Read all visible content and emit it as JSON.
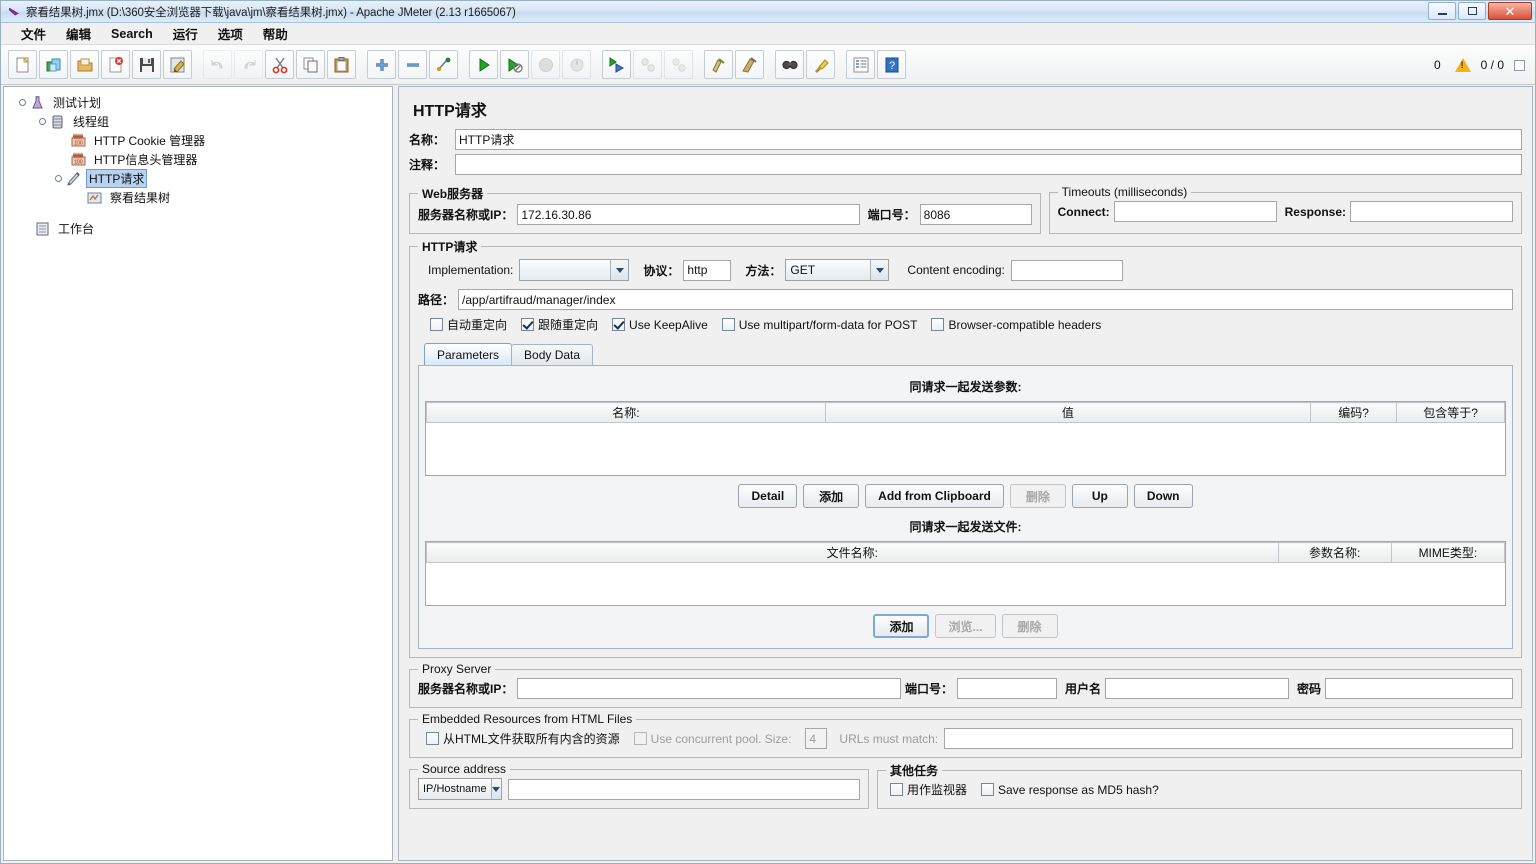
{
  "window": {
    "title": "察看结果树.jmx (D:\\360安全浏览器下载\\java\\jm\\察看结果树.jmx) - Apache JMeter (2.13 r1665067)",
    "minimize": "−",
    "maximize": "□",
    "close": "✕"
  },
  "menu": {
    "items": [
      "文件",
      "编辑",
      "Search",
      "运行",
      "选项",
      "帮助"
    ]
  },
  "toolbar": {
    "icons": [
      "new-icon",
      "templates-icon",
      "open-icon",
      "close-icon",
      "save-icon",
      "save-as-icon",
      "undo-icon",
      "redo-icon",
      "cut-icon",
      "copy-icon",
      "paste-icon",
      "expand-icon",
      "collapse-icon",
      "toggle-icon",
      "start-icon",
      "start-no-timers-icon",
      "stop-icon",
      "shutdown-icon",
      "remote-start-all-icon",
      "remote-stop-all-icon",
      "remote-shutdown-all-icon",
      "clear-icon",
      "clear-all-icon",
      "search-icon",
      "search-reset-icon",
      "function-helper-icon",
      "help-icon"
    ],
    "warning_count": "0",
    "thread_count": "0 / 0"
  },
  "tree": {
    "nodes": [
      {
        "label": "测试计划",
        "icon": "test-plan-icon",
        "depth": 0,
        "selected": false,
        "expander": true
      },
      {
        "label": "线程组",
        "icon": "thread-group-icon",
        "depth": 1,
        "selected": false,
        "expander": true
      },
      {
        "label": "HTTP Cookie 管理器",
        "icon": "cookie-manager-icon",
        "depth": 2,
        "selected": false,
        "expander": false
      },
      {
        "label": "HTTP信息头管理器",
        "icon": "header-manager-icon",
        "depth": 2,
        "selected": false,
        "expander": false
      },
      {
        "label": "HTTP请求",
        "icon": "http-request-icon",
        "depth": 2,
        "selected": true,
        "expander": true
      },
      {
        "label": "察看结果树",
        "icon": "view-results-tree-icon",
        "depth": 3,
        "selected": false,
        "expander": false
      },
      {
        "label": "工作台",
        "icon": "workbench-icon",
        "depth": 0,
        "selected": false,
        "expander": false
      }
    ]
  },
  "panel": {
    "title": "HTTP请求",
    "name_label": "名称：",
    "name_value": "HTTP请求",
    "comment_label": "注释：",
    "comment_value": "",
    "webserver": {
      "legend": "Web服务器",
      "server_label": "服务器名称或IP：",
      "server_value": "172.16.30.86",
      "port_label": "端口号：",
      "port_value": "8086"
    },
    "timeouts": {
      "legend": "Timeouts (milliseconds)",
      "connect_label": "Connect:",
      "connect_value": "",
      "response_label": "Response:",
      "response_value": ""
    },
    "httprequest": {
      "legend": "HTTP请求",
      "implementation_label": "Implementation:",
      "implementation_value": "",
      "protocol_label": "协议：",
      "protocol_value": "http",
      "method_label": "方法：",
      "method_value": "GET",
      "content_encoding_label": "Content encoding:",
      "content_encoding_value": "",
      "path_label": "路径：",
      "path_value": "/app/artifraud/manager/index",
      "checkboxes": [
        {
          "label": "自动重定向",
          "checked": false
        },
        {
          "label": "跟随重定向",
          "checked": true
        },
        {
          "label": "Use KeepAlive",
          "checked": true
        },
        {
          "label": "Use multipart/form-data for POST",
          "checked": false
        },
        {
          "label": "Browser-compatible headers",
          "checked": false
        }
      ],
      "tabs": [
        {
          "label": "Parameters",
          "active": true
        },
        {
          "label": "Body Data",
          "active": false
        }
      ],
      "params_table": {
        "caption": "同请求一起发送参数:",
        "columns": [
          "名称:",
          "值",
          "编码?",
          "包含等于?"
        ],
        "rows": []
      },
      "params_buttons": [
        {
          "label": "Detail",
          "enabled": true,
          "focused": false
        },
        {
          "label": "添加",
          "enabled": true,
          "focused": false
        },
        {
          "label": "Add from Clipboard",
          "enabled": true,
          "focused": false
        },
        {
          "label": "删除",
          "enabled": false,
          "focused": false
        },
        {
          "label": "Up",
          "enabled": true,
          "focused": false
        },
        {
          "label": "Down",
          "enabled": true,
          "focused": false
        }
      ],
      "files_table": {
        "caption": "同请求一起发送文件:",
        "columns": [
          "文件名称:",
          "参数名称:",
          "MIME类型:"
        ],
        "rows": []
      },
      "files_buttons": [
        {
          "label": "添加",
          "enabled": true,
          "focused": true
        },
        {
          "label": "浏览...",
          "enabled": false,
          "focused": false
        },
        {
          "label": "删除",
          "enabled": false,
          "focused": false
        }
      ]
    },
    "proxy": {
      "legend": "Proxy Server",
      "server_label": "服务器名称或IP：",
      "server_value": "",
      "port_label": "端口号：",
      "port_value": "",
      "username_label": "用户名",
      "username_value": "",
      "password_label": "密码",
      "password_value": ""
    },
    "embedded": {
      "legend": "Embedded Resources from HTML Files",
      "retrieve_label": "从HTML文件获取所有内含的资源",
      "retrieve_checked": false,
      "pool_label": "Use concurrent pool. Size:",
      "pool_checked": false,
      "pool_size": "4",
      "urls_label": "URLs must match:",
      "urls_value": ""
    },
    "source_address": {
      "legend": "Source address",
      "type_value": "IP/Hostname",
      "value": ""
    },
    "other": {
      "legend": "其他任务",
      "monitor_label": "用作监视器",
      "monitor_checked": false,
      "md5_label": "Save response as MD5 hash?",
      "md5_checked": false
    }
  },
  "colors": {
    "accent": "#b6d3f0",
    "titlebar": "#d6e6f5",
    "warning": "#f2b31a"
  }
}
